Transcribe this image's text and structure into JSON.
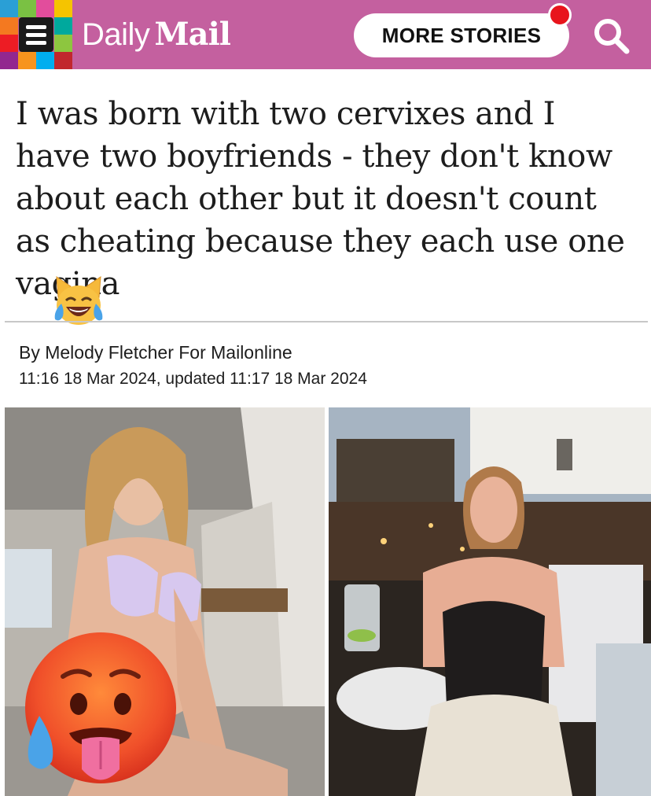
{
  "header": {
    "brand_part1": "Daily",
    "brand_part2": "Mail",
    "more_stories_label": "MORE STORIES",
    "bg_color": "#c4609f",
    "notification_color": "#e8141c",
    "icons": [
      "menu-icon",
      "search-icon",
      "notification-dot-icon"
    ]
  },
  "article": {
    "headline": "I was born with two cervixes and I have two boyfriends - they don't know about each other but it doesn't count as cheating because they each use one vagina",
    "byline": "By Melody Fletcher For Mailonline",
    "timestamp": "11:16 18 Mar 2024, updated 11:17 18 Mar 2024"
  },
  "overlays": {
    "emoji_1": "laughing-cat-with-tears-emoji",
    "emoji_2": "hot-face-emoji"
  },
  "photos": [
    {
      "name": "photo-left",
      "description_icon": "photo-image"
    },
    {
      "name": "photo-right",
      "description_icon": "photo-image"
    }
  ]
}
